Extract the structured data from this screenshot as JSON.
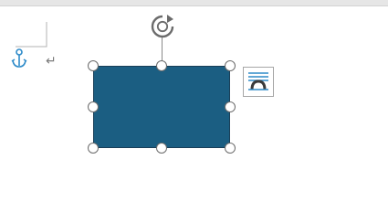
{
  "document": {
    "paragraph_mark": "↵"
  },
  "shape": {
    "kind": "rectangle",
    "fill_color": "#1b5e82",
    "outline_color": "#1a3f58",
    "selected": true
  },
  "icons": {
    "anchor": "anchor-icon",
    "rotate": "rotate-icon",
    "layout_options": "layout-options-icon"
  },
  "colors": {
    "anchor": "#2e8bc9",
    "handle_border": "#6b6b6b"
  }
}
